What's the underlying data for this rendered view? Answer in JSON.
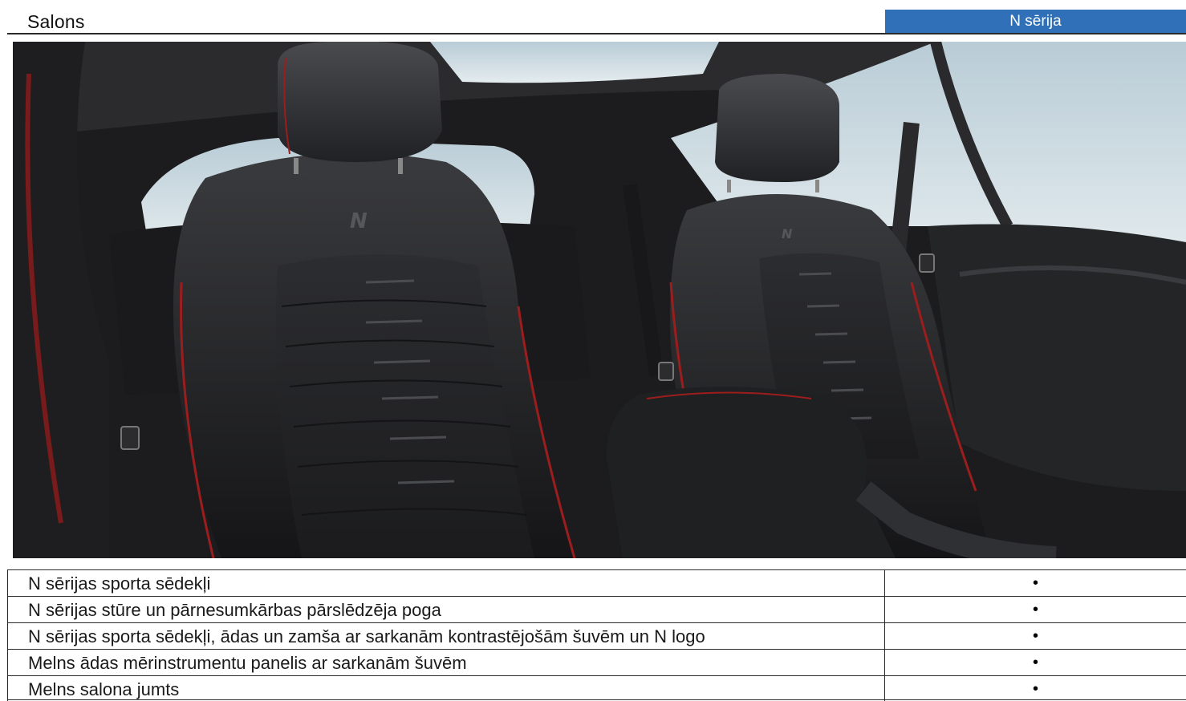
{
  "header": {
    "title": "Salons",
    "series_label": "N sērija",
    "series_color": "#2f70b8"
  },
  "photo": {
    "alt": "",
    "seat_logo": "N"
  },
  "features": [
    {
      "name": "N sērijas sporta sēdekļi",
      "mark": "•"
    },
    {
      "name": "N sērijas stūre un pārnesumkārbas pārslēdzēja poga",
      "mark": "•"
    },
    {
      "name": "N sērijas sporta sēdekļi, ādas un zamša ar sarkanām kontrastējošām šuvēm un N logo",
      "mark": "•"
    },
    {
      "name": "Melns ādas mērinstrumentu panelis ar sarkanām šuvēm",
      "mark": "•"
    },
    {
      "name": "Melns salona jumts",
      "mark": "•"
    }
  ]
}
